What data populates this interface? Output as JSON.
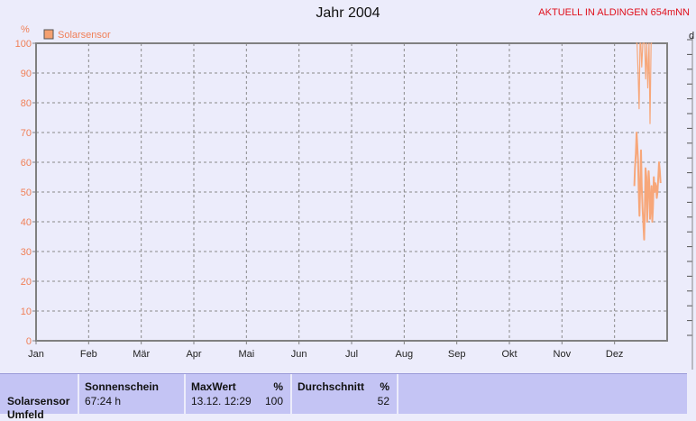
{
  "header": {
    "title": "Jahr 2004",
    "note": "AKTUELL IN ALDINGEN 654mNN"
  },
  "colors": {
    "series": "#f7a77a",
    "series_legend_swatch": "#f4a070",
    "axis_text": "#f08058",
    "plot_border": "#808080",
    "grid": "#8a8a8a",
    "note": "#e0101c",
    "panel": "#c4c4f4"
  },
  "chart_data": {
    "type": "line",
    "title": "Jahr 2004",
    "ylabel": "%",
    "ylim": [
      0,
      100
    ],
    "yticks": [
      0,
      10,
      20,
      30,
      40,
      50,
      60,
      70,
      80,
      90,
      100
    ],
    "xlim": [
      0,
      365
    ],
    "x_unit": "day of year 2004",
    "categories": [
      "Jan",
      "Feb",
      "Mär",
      "Apr",
      "Mai",
      "Jun",
      "Jul",
      "Aug",
      "Sep",
      "Okt",
      "Nov",
      "Dez"
    ],
    "grid": true,
    "legend_position": "top-left",
    "right_axis_label": "d",
    "series": [
      {
        "name": "Solarsensor",
        "segments": [
          {
            "x": [
              347.0,
              347.6,
              348.2,
              348.8,
              349.3,
              349.8,
              350.3,
              350.9,
              351.4,
              352.0,
              352.6,
              353.2,
              353.8,
              354.5,
              355.1,
              355.7,
              356.3
            ],
            "y": [
              100,
              100,
              90,
              78,
              100,
              100,
              92,
              100,
              100,
              100,
              88,
              100,
              85,
              100,
              73,
              100,
              100
            ]
          },
          {
            "x": [
              346.0,
              346.4,
              346.9,
              347.3,
              347.7,
              348.2,
              348.6,
              349.0,
              349.5,
              349.9,
              350.3,
              350.8,
              351.2,
              351.7,
              352.1,
              352.5,
              353.0,
              353.4,
              353.8,
              354.3,
              354.7,
              355.1,
              355.6,
              356.0,
              356.4,
              356.8,
              357.3,
              357.7,
              358.1,
              358.6,
              359.0,
              359.4,
              359.9,
              360.3,
              360.8,
              361.2
            ],
            "y": [
              52,
              58,
              63,
              70,
              66,
              60,
              50,
              42,
              55,
              64,
              52,
              44,
              40,
              34,
              45,
              58,
              55,
              40,
              48,
              57,
              53,
              41,
              47,
              52,
              40,
              45,
              55,
              50,
              53,
              52,
              48,
              50,
              55,
              60,
              57,
              53
            ]
          }
        ]
      }
    ]
  },
  "stats": {
    "row_label_1": "Solarsensor",
    "row_label_2": "Umfeld",
    "sun_header": "Sonnenschein",
    "sun_value": "67:24 h",
    "max_header": "MaxWert",
    "max_unit": "%",
    "max_time": "13.12.  12:29",
    "max_value": "100",
    "avg_header": "Durchschnitt",
    "avg_unit": "%",
    "avg_value": "52"
  }
}
